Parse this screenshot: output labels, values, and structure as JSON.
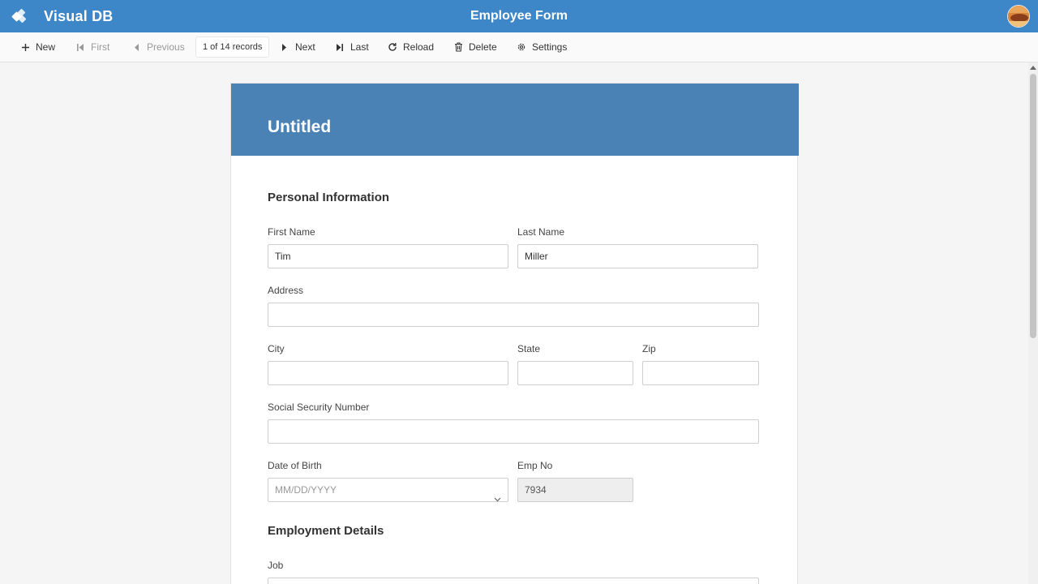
{
  "app": {
    "name": "Visual DB",
    "form_title": "Employee Form"
  },
  "toolbar": {
    "new": "New",
    "first": "First",
    "previous": "Previous",
    "records": "1 of 14 records",
    "next": "Next",
    "last": "Last",
    "reload": "Reload",
    "delete": "Delete",
    "settings": "Settings"
  },
  "form": {
    "title": "Untitled",
    "sections": {
      "personal": "Personal Information",
      "employment": "Employment Details"
    },
    "fields": {
      "first_name": {
        "label": "First Name",
        "value": "Tim"
      },
      "last_name": {
        "label": "Last Name",
        "value": "Miller"
      },
      "address": {
        "label": "Address",
        "value": ""
      },
      "city": {
        "label": "City",
        "value": ""
      },
      "state": {
        "label": "State",
        "value": ""
      },
      "zip": {
        "label": "Zip",
        "value": ""
      },
      "ssn": {
        "label": "Social Security Number",
        "value": ""
      },
      "dob": {
        "label": "Date of Birth",
        "placeholder": "MM/DD/YYYY"
      },
      "emp_no": {
        "label": "Emp No",
        "value": "7934"
      },
      "job": {
        "label": "Job",
        "value": ""
      }
    }
  },
  "colors": {
    "header": "#3d87c8",
    "form_header": "#4a82b6"
  }
}
